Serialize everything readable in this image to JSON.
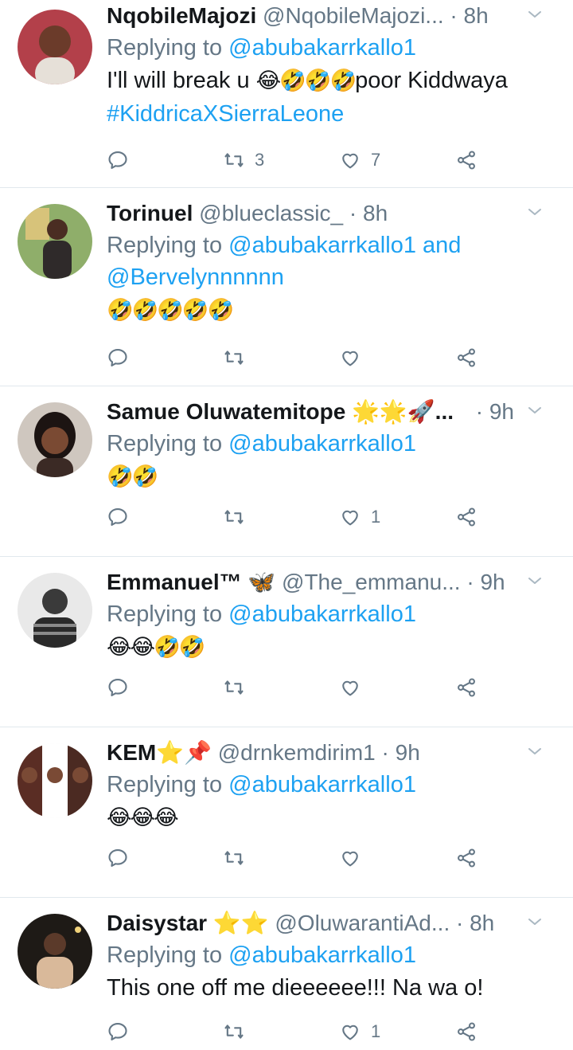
{
  "tweets": [
    {
      "name": "NqobileMajozi",
      "handle": "@NqobileMajozi...",
      "time": "· 8h",
      "reply_prefix": "Replying to ",
      "reply_to": "@abubakarrkallo1",
      "reply_to_2": "",
      "text": "I'll will break u ",
      "emoji": "😂🤣🤣🤣",
      "text_after": "poor Kiddwaya",
      "hashtag": "#KiddricaXSierraLeone",
      "retweets": "3",
      "likes": "7"
    },
    {
      "name": "Torinuel",
      "handle": "@blueclassic_",
      "time": "· 8h",
      "reply_prefix": "Replying to ",
      "reply_to": "@abubakarrkallo1",
      "reply_and": " and",
      "reply_to_2": "@Bervelynnnnnn",
      "emoji": "🤣🤣🤣🤣🤣",
      "retweets": "",
      "likes": ""
    },
    {
      "name": "Samue Oluwatemitope 🌟🌟🚀...",
      "handle": "",
      "time": "· 9h",
      "reply_prefix": "Replying to ",
      "reply_to": "@abubakarrkallo1",
      "emoji": "🤣🤣",
      "retweets": "",
      "likes": "1"
    },
    {
      "name": "Emmanuel™ 🦋",
      "handle": "@The_emmanu...",
      "time": "· 9h",
      "reply_prefix": "Replying to ",
      "reply_to": "@abubakarrkallo1",
      "emoji": "😂😂🤣🤣",
      "retweets": "",
      "likes": ""
    },
    {
      "name": "KEM⭐📌",
      "handle": "@drnkemdirim1",
      "time": "· 9h",
      "reply_prefix": "Replying to ",
      "reply_to": "@abubakarrkallo1",
      "emoji": "😂😂😂",
      "retweets": "",
      "likes": ""
    },
    {
      "name": "Daisystar ⭐⭐",
      "handle": "@OluwarantiAd...",
      "time": "· 8h",
      "reply_prefix": "Replying to ",
      "reply_to": "@abubakarrkallo1",
      "text": "This one off me dieeeeee!!! Na wa o!",
      "retweets": "",
      "likes": "1"
    }
  ],
  "colors": {
    "link": "#1da1f2",
    "muted": "#657786",
    "text": "#14171a",
    "divider": "#e1e8ed"
  },
  "icons": [
    "reply-icon",
    "retweet-icon",
    "like-icon",
    "share-icon",
    "chevron-down-icon"
  ]
}
